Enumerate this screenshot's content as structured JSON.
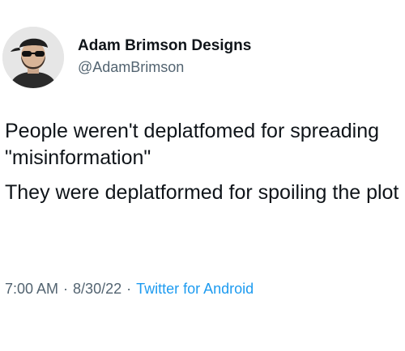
{
  "author": {
    "display_name": "Adam Brimson Designs",
    "handle": "@AdamBrimson",
    "avatar_icon": "profile-photo-avatar"
  },
  "tweet": {
    "paragraphs": [
      "People weren't deplatfomed for spreading \"misinformation\"",
      "They were deplatformed for spoiling the plot"
    ]
  },
  "meta": {
    "time": "7:00 AM",
    "separator": "·",
    "date": "8/30/22",
    "source": "Twitter for Android"
  },
  "colors": {
    "text": "#0f1419",
    "secondary": "#536471",
    "link": "#1d9bf0",
    "background": "#ffffff"
  }
}
